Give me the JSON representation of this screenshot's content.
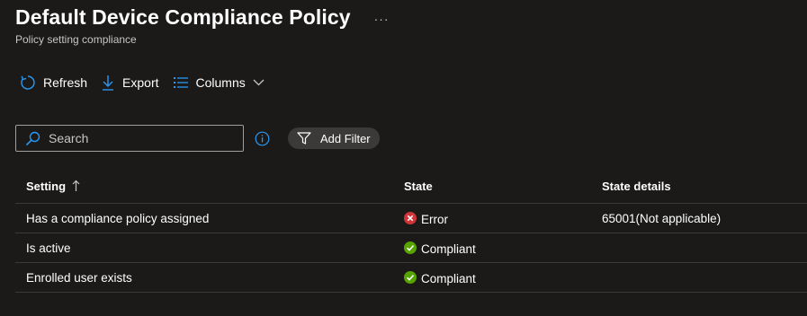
{
  "header": {
    "title": "Default Device Compliance Policy",
    "more_label": "···",
    "subtitle": "Policy setting compliance"
  },
  "toolbar": {
    "refresh_label": "Refresh",
    "export_label": "Export",
    "columns_label": "Columns"
  },
  "search": {
    "placeholder": "Search",
    "value": ""
  },
  "filter": {
    "add_filter_label": "Add Filter"
  },
  "table": {
    "columns": [
      "Setting",
      "State",
      "State details"
    ],
    "sort_icon": "arrow-up-icon",
    "rows": [
      {
        "setting": "Has a compliance policy assigned",
        "state": "Error",
        "state_icon": "error-icon",
        "details": "65001(Not applicable)"
      },
      {
        "setting": "Is active",
        "state": "Compliant",
        "state_icon": "check-icon",
        "details": ""
      },
      {
        "setting": "Enrolled user exists",
        "state": "Compliant",
        "state_icon": "check-icon",
        "details": ""
      }
    ]
  },
  "colors": {
    "background": "#1b1a19",
    "accent": "#2899f5",
    "error": "#d13438",
    "success": "#57a300",
    "divider": "#3b3a39"
  }
}
